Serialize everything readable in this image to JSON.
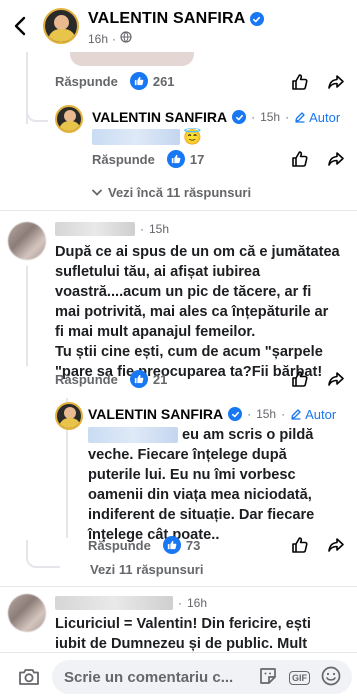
{
  "header": {
    "name": "VALENTIN SANFIRA",
    "time": "16h"
  },
  "comment0": {
    "reply_label": "Răspunde",
    "likes": "261"
  },
  "reply1": {
    "name": "VALENTIN SANFIRA",
    "time": "15h",
    "author_label": "Autor",
    "emoji": "😇",
    "reply_label": "Răspunde",
    "likes": "17",
    "more_replies": "Vezi încă 11 răspunsuri"
  },
  "comment2": {
    "time": "15h",
    "text_lines": [
      "După ce ai spus de un om că e jumătatea",
      "sufletului tău, ai afișat iubirea",
      "voastră....acum un pic de tăcere, ar fi",
      "mai potrivită, mai ales ca înțepăturile ar",
      "fi mai mult apanajul femeilor.",
      "Tu știi cine ești, cum de acum \"șarpele",
      "\"pare sa fie preocuparea ta?Fii bărbat!"
    ],
    "reply_label": "Răspunde",
    "likes": "21"
  },
  "reply2": {
    "name": "VALENTIN SANFIRA",
    "time": "15h",
    "author_label": "Autor",
    "first_line_tail": "eu am scris o pildă",
    "text_lines": [
      "veche. Fiecare înțelege după",
      "puterile lui. Eu nu îmi vorbesc",
      "oamenii din viața mea niciodată,",
      "indiferent de situație. Dar fiecare",
      "înțelege cât poate.."
    ],
    "reply_label": "Răspunde",
    "likes": "73",
    "more_replies": "Vezi 11 răspunsuri"
  },
  "comment3": {
    "time": "16h",
    "text_lines": [
      "Licuriciul = Valentin! Din fericire, ești",
      "iubit de Dumnezeu și de public. Mult"
    ]
  },
  "composer": {
    "placeholder": "Scrie un comentariu c..."
  },
  "colors": {
    "accent": "#1877f2",
    "muted": "#65676b"
  }
}
